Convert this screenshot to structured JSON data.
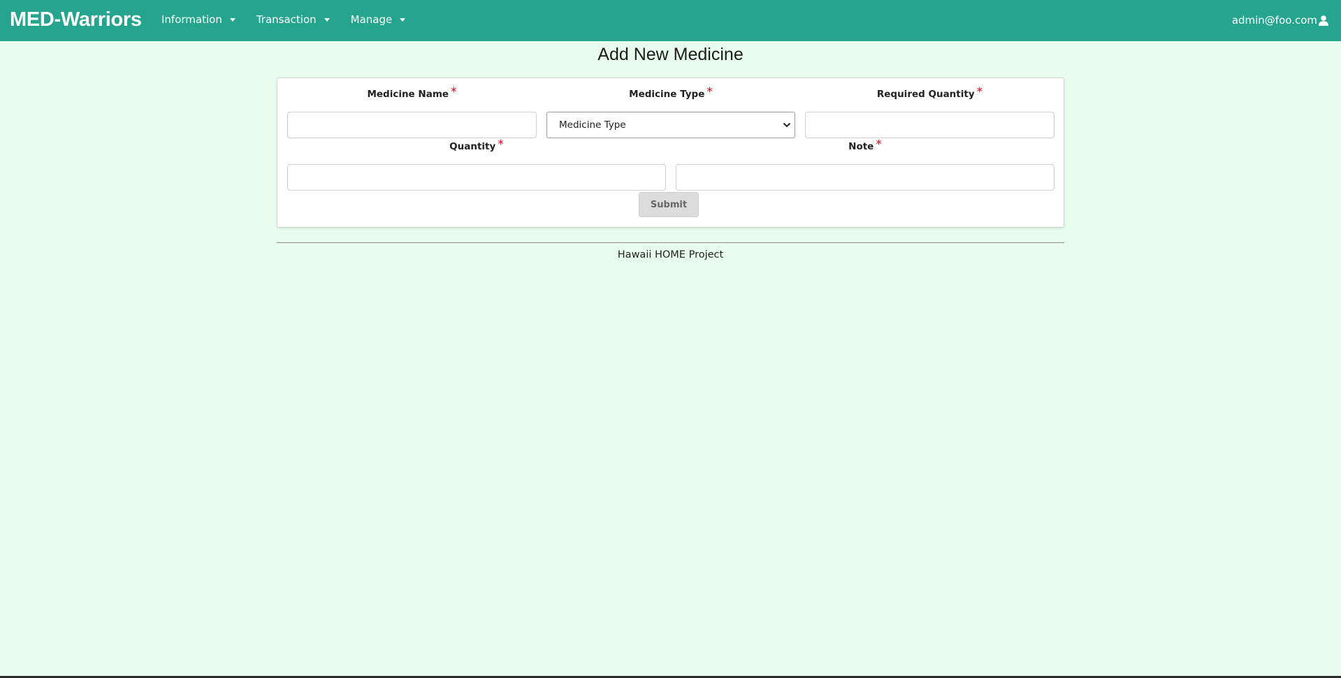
{
  "navbar": {
    "brand": "MED-Warriors",
    "menu": [
      {
        "label": "Information"
      },
      {
        "label": "Transaction"
      },
      {
        "label": "Manage"
      }
    ],
    "user": "admin@foo.com",
    "background_color": "#25a48e"
  },
  "page": {
    "title": "Add New Medicine",
    "background_color": "#e8fdee"
  },
  "form": {
    "fields": {
      "medicine_name": {
        "label": "Medicine Name",
        "required_mark": "*",
        "value": ""
      },
      "medicine_type": {
        "label": "Medicine Type",
        "required_mark": "*",
        "selected": "Medicine Type"
      },
      "required_quantity": {
        "label": "Required Quantity",
        "required_mark": "*",
        "value": ""
      },
      "quantity": {
        "label": "Quantity",
        "required_mark": "*",
        "value": ""
      },
      "note": {
        "label": "Note",
        "required_mark": "*",
        "value": ""
      }
    },
    "submit_label": "Submit"
  },
  "footer": {
    "text": "Hawaii HOME Project"
  }
}
